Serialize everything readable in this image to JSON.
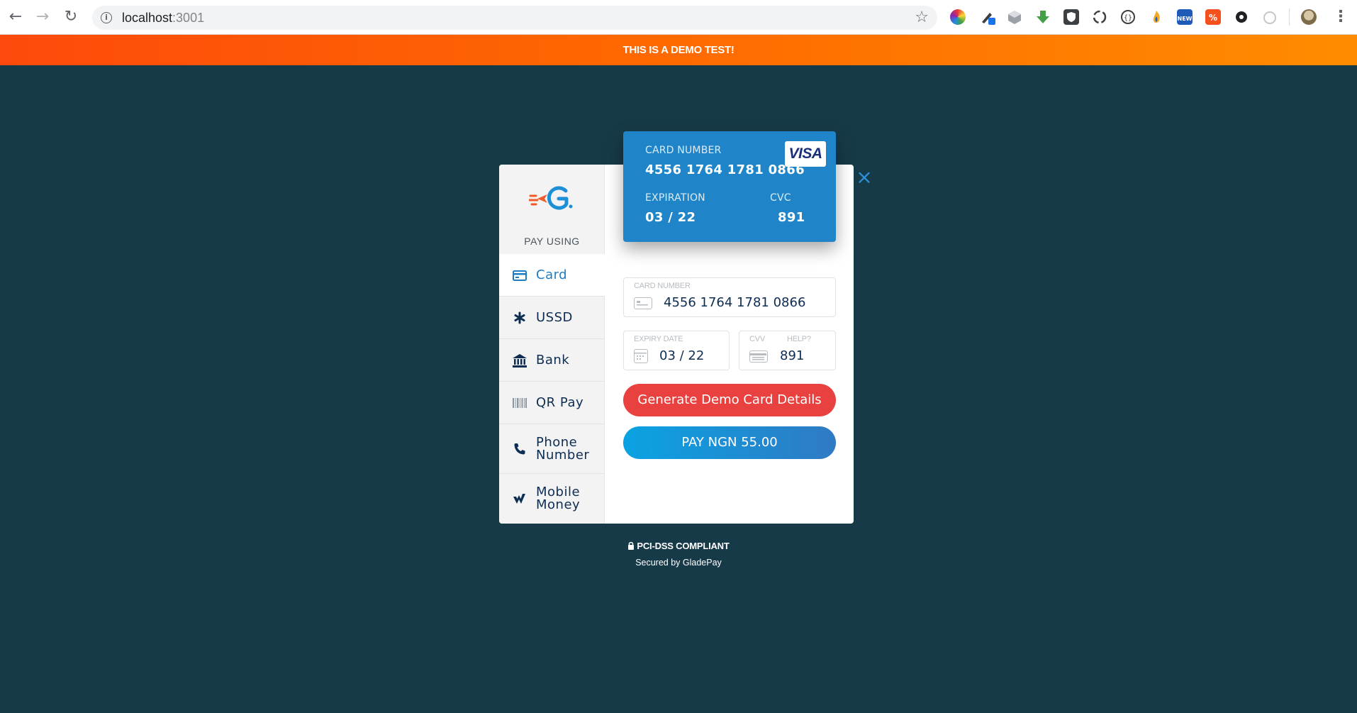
{
  "browser": {
    "url_host": "localhost",
    "url_port": ":3001"
  },
  "banner": {
    "text": "THIS IS A DEMO TEST!"
  },
  "sidebar": {
    "heading": "PAY USING",
    "methods": [
      {
        "label": "Card",
        "icon": "card-icon",
        "active": true
      },
      {
        "label": "USSD",
        "icon": "asterisk-icon"
      },
      {
        "label": "Bank",
        "icon": "bank-icon"
      },
      {
        "label": "QR Pay",
        "icon": "barcode-icon"
      },
      {
        "label": "Phone Number",
        "line1": "Phone",
        "line2": "Number",
        "icon": "phone-icon"
      },
      {
        "label": "Mobile Money",
        "line1": "Mobile",
        "line2": "Money",
        "icon": "mobile-money-icon"
      }
    ]
  },
  "card_preview": {
    "number_label": "CARD NUMBER",
    "number": "4556 1764 1781 0866",
    "expiry_label": "EXPIRATION",
    "expiry": "03 / 22",
    "cvc_label": "CVC",
    "cvc": "891",
    "brand": "VISA"
  },
  "form": {
    "card_number_label": "CARD NUMBER",
    "card_number": "4556 1764 1781 0866",
    "expiry_label": "EXPIRY DATE",
    "expiry": "03 / 22",
    "cvv_label": "CVV",
    "help_label": "HELP?",
    "cvv": "891"
  },
  "actions": {
    "generate_label": "Generate Demo Card Details",
    "pay_label": "PAY NGN 55.00"
  },
  "footer": {
    "pci": "PCI-DSS COMPLIANT",
    "secured": "Secured by GladePay"
  },
  "colors": {
    "background": "#173a48",
    "accent": "#1f85c8",
    "demo_button": "#e8413f",
    "banner_start": "#fd4a0c",
    "banner_end": "#ff8c00"
  }
}
